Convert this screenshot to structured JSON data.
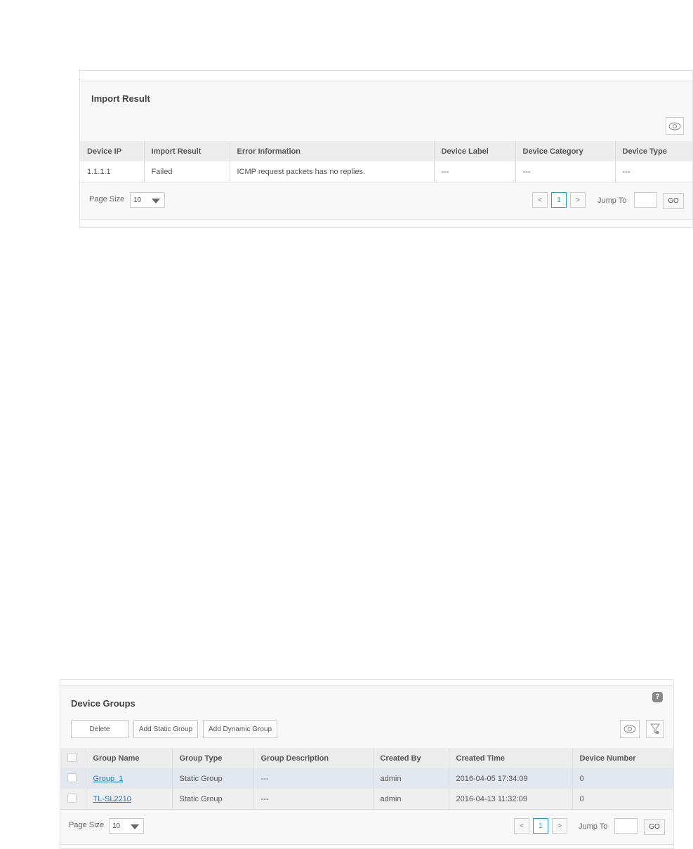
{
  "import_result": {
    "title": "Import Result",
    "columns": [
      "Device IP",
      "Import Result",
      "Error Information",
      "Device Label",
      "Device Category",
      "Device Type"
    ],
    "rows": [
      [
        "1.1.1.1",
        "Failed",
        "ICMP request packets has no replies.",
        "---",
        "---",
        "---"
      ]
    ],
    "page_size_label": "Page Size",
    "page_size": "10",
    "prev": "<",
    "page": "1",
    "next": ">",
    "jump_label": "Jump To",
    "jump_value": "",
    "go": "GO"
  },
  "device_groups": {
    "title": "Device Groups",
    "buttons": {
      "delete": "Delete",
      "add_static": "Add Static Group",
      "add_dynamic": "Add Dynamic Group"
    },
    "columns": [
      "Group Name",
      "Group Type",
      "Group Description",
      "Created By",
      "Created Time",
      "Device Number"
    ],
    "rows": [
      [
        "Group_1",
        "Static Group",
        "---",
        "admin",
        "2016-04-05 17:34:09",
        "0"
      ],
      [
        "TL-SL2210",
        "Static Group",
        "---",
        "admin",
        "2016-04-13 11:32:09",
        "0"
      ]
    ],
    "page_size_label": "Page Size",
    "page_size": "10",
    "prev": "<",
    "page": "1",
    "next": ">",
    "jump_label": "Jump To",
    "jump_value": "",
    "go": "GO",
    "help": "?"
  },
  "colors": {
    "accent": "#1a9ae0",
    "link": "#1a7ad8",
    "selected_row": "#e3e8ee"
  }
}
